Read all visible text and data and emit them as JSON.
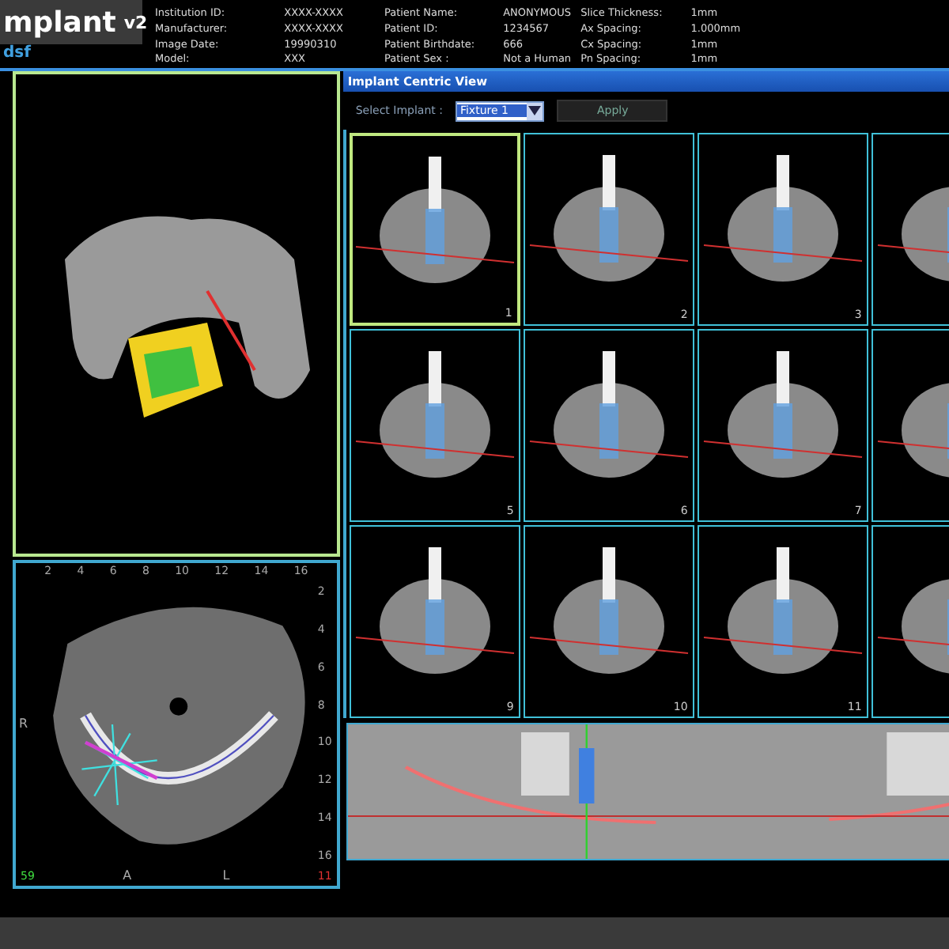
{
  "header": {
    "logo": "mplant",
    "version": "v2",
    "subtitle": "dsf",
    "info_groups": [
      [
        {
          "label": "Institution ID:",
          "value": "XXXX-XXXX"
        },
        {
          "label": "Manufacturer:",
          "value": "XXXX-XXXX"
        },
        {
          "label": "Image Date:",
          "value": "19990310"
        },
        {
          "label": "Model:",
          "value": "XXX"
        }
      ],
      [
        {
          "label": "Patient Name:",
          "value": "ANONYMOUS"
        },
        {
          "label": "Patient ID:",
          "value": "1234567"
        },
        {
          "label": "Patient Birthdate:",
          "value": "666"
        },
        {
          "label": "Patient Sex :",
          "value": "Not a Human"
        }
      ],
      [
        {
          "label": "Slice Thickness:",
          "value": "1mm"
        },
        {
          "label": "Ax Spacing:",
          "value": "1.000mm"
        },
        {
          "label": "Cx Spacing:",
          "value": "1mm"
        },
        {
          "label": "Pn Spacing:",
          "value": "1mm"
        }
      ]
    ]
  },
  "axial_view": {
    "top_ticks": [
      "2",
      "4",
      "6",
      "8",
      "10",
      "12",
      "14",
      "16"
    ],
    "right_ticks": [
      "2",
      "4",
      "6",
      "8",
      "10",
      "12",
      "14",
      "16"
    ],
    "left_label": "R",
    "right_label": "L",
    "bottom_label": "A",
    "angle_label": "59",
    "slice_number": "11"
  },
  "implant_view": {
    "title": "Implant Centric View",
    "select_label": "Select Implant :",
    "select_value": "Fixture 1",
    "apply_button": "Apply",
    "slices": [
      {
        "number": "1",
        "selected": true
      },
      {
        "number": "2",
        "selected": false
      },
      {
        "number": "3",
        "selected": false
      },
      {
        "selected": false
      },
      {
        "number": "5",
        "selected": false
      },
      {
        "number": "6",
        "selected": false
      },
      {
        "number": "7",
        "selected": false
      },
      {
        "selected": false
      },
      {
        "number": "9",
        "selected": false
      },
      {
        "number": "10",
        "selected": false
      },
      {
        "number": "11",
        "selected": false
      },
      {
        "selected": false
      }
    ]
  }
}
